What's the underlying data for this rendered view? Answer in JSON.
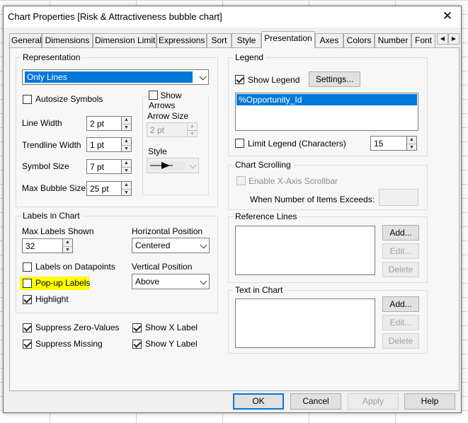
{
  "window": {
    "title": "Chart Properties [Risk & Attractiveness bubble chart]"
  },
  "tabs": [
    {
      "label": "General"
    },
    {
      "label": "Dimensions"
    },
    {
      "label": "Dimension Limits"
    },
    {
      "label": "Expressions"
    },
    {
      "label": "Sort"
    },
    {
      "label": "Style"
    },
    {
      "label": "Presentation"
    },
    {
      "label": "Axes"
    },
    {
      "label": "Colors"
    },
    {
      "label": "Number"
    },
    {
      "label": "Font"
    }
  ],
  "active_tab": "Presentation",
  "representation": {
    "title": "Representation",
    "selected": "Only Lines",
    "autosize_symbols": "Autosize Symbols",
    "line_width_label": "Line Width",
    "line_width": "2 pt",
    "trendline_width_label": "Trendline Width",
    "trendline_width": "1 pt",
    "symbol_size_label": "Symbol Size",
    "symbol_size": "7 pt",
    "max_bubble_size_label": "Max Bubble Size",
    "max_bubble_size": "25 pt",
    "show_arrows": "Show Arrows",
    "arrow_size_label": "Arrow Size",
    "arrow_size": "2 pt",
    "style_label": "Style"
  },
  "labels_in_chart": {
    "title": "Labels in Chart",
    "max_labels_shown_label": "Max Labels Shown",
    "max_labels_shown": "32",
    "horizontal_position_label": "Horizontal Position",
    "horizontal_position": "Centered",
    "labels_on_datapoints": "Labels on Datapoints",
    "vertical_position_label": "Vertical Position",
    "vertical_position": "Above",
    "popup_labels": "Pop-up Labels",
    "highlight": "Highlight"
  },
  "options": {
    "suppress_zero_values": "Suppress Zero-Values",
    "show_x_label": "Show X Label",
    "suppress_missing": "Suppress Missing",
    "show_y_label": "Show Y Label"
  },
  "legend": {
    "title": "Legend",
    "show_legend": "Show Legend",
    "settings_button": "Settings...",
    "items": [
      "%Opportunity_Id"
    ],
    "limit_legend": "Limit Legend (Characters)",
    "limit_value": "15"
  },
  "chart_scrolling": {
    "title": "Chart Scrolling",
    "enable_scrollbar": "Enable X-Axis Scrollbar",
    "when_exceeds": "When Number of Items Exceeds:"
  },
  "reference_lines": {
    "title": "Reference Lines",
    "add": "Add...",
    "edit": "Edit...",
    "delete": "Delete"
  },
  "text_in_chart": {
    "title": "Text in Chart",
    "add": "Add...",
    "edit": "Edit...",
    "delete": "Delete"
  },
  "footer": {
    "ok": "OK",
    "cancel": "Cancel",
    "apply": "Apply",
    "help": "Help"
  },
  "colors": {
    "accent": "#0078d7",
    "highlight": "#ffff00"
  }
}
